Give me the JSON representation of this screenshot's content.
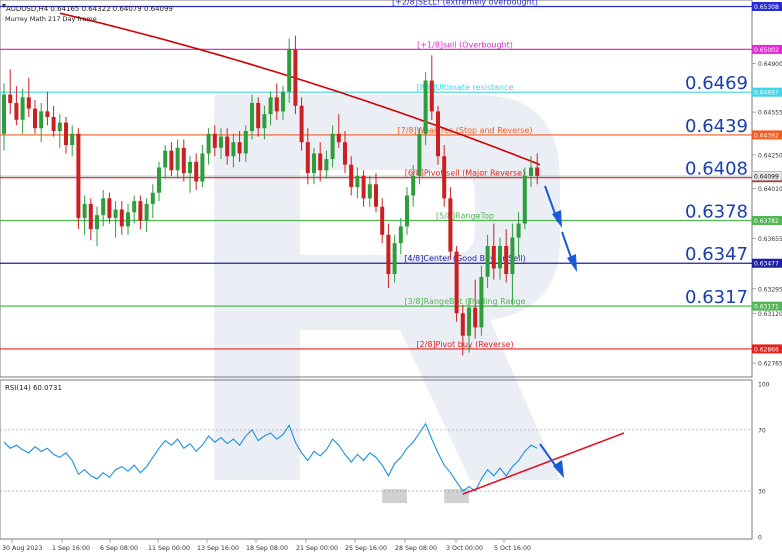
{
  "header": {
    "symbol_line": "AUDUSD,H4  0.64165 0.64322 0.64079 0.64099",
    "indicator_name": "Murrey Math 217 Day frame"
  },
  "colors": {
    "bull_candle": "#2e9e3c",
    "bear_candle": "#cc1f1f",
    "ma_line": "#d40000",
    "rsi_line": "#1e8fe0",
    "rsi_trend_line": "#e0162b",
    "arrow": "#1a5ad6"
  },
  "chart_data": [
    {
      "type": "candlestick",
      "ylim": [
        0.6268,
        0.6534
      ],
      "price_axis_ticks": [
        "0.65308",
        "0.65002",
        "0.64900",
        "0.64697",
        "0.64555",
        "0.64392",
        "0.64250",
        "0.64087",
        "0.64010",
        "0.63782",
        "0.63655",
        "0.63477",
        "0.63295",
        "0.63171",
        "0.63120",
        "0.62866",
        "0.62765"
      ],
      "x_labels": [
        "30 Aug 2023",
        "1 Sep 16:00",
        "6 Sep 08:00",
        "11 Sep 00:00",
        "13 Sep 16:00",
        "18 Sep 08:00",
        "21 Sep 00:00",
        "25 Sep 16:00",
        "28 Sep 08:00",
        "3 Oct 00:00",
        "5 Oct 16:00"
      ],
      "murrey_levels": [
        {
          "label": "[+2/8]SELL! (extremely overbought)",
          "value": 0.65308,
          "color": "#2a2ad6",
          "tag": "0.65308",
          "big": ""
        },
        {
          "label": "[+1/8]sell (Overbought)",
          "value": 0.65002,
          "color": "#e62ad6",
          "tag": "0.65002",
          "big": ""
        },
        {
          "label": "[8/8]Ultimate resistance",
          "value": 0.64697,
          "color": "#3fd6e6",
          "tag": "0.64697",
          "big": "0.6469"
        },
        {
          "label": "[7/8]Weak res (Stop and Reverse)",
          "value": 0.64392,
          "color": "#f25c1f",
          "tag": "0.64392",
          "big": "0.6439"
        },
        {
          "label": "[6/8]Pivot sell (Major Reverse)",
          "value": 0.64087,
          "color": "#e62020",
          "tag": "0.64087",
          "big": "0.6408"
        },
        {
          "label": "[5/8]RangeTop",
          "value": 0.63782,
          "color": "#52b652",
          "tag": "0.63782",
          "big": "0.6378"
        },
        {
          "label": "[4/8]Center (Good Buy or Sell)",
          "value": 0.63477,
          "color": "#1f1fa8",
          "tag": "0.63477",
          "big": "0.6347"
        },
        {
          "label": "[3/8]RangeBot (Trading Range",
          "value": 0.63171,
          "color": "#52b652",
          "tag": "0.63171",
          "big": "0.6317"
        },
        {
          "label": "[2/8]Pivot buy (Reverse)",
          "value": 0.62866,
          "color": "#e62020",
          "tag": "0.62866",
          "big": ""
        }
      ],
      "current_price": {
        "value": 0.64099,
        "tag": "0.64099"
      },
      "candles": [
        [
          0.644,
          0.6476,
          0.6428,
          0.6468
        ],
        [
          0.6468,
          0.6486,
          0.6454,
          0.6462
        ],
        [
          0.6462,
          0.6474,
          0.6446,
          0.645
        ],
        [
          0.645,
          0.6472,
          0.644,
          0.6466
        ],
        [
          0.6466,
          0.648,
          0.6452,
          0.6458
        ],
        [
          0.6458,
          0.6464,
          0.644,
          0.6444
        ],
        [
          0.6444,
          0.6462,
          0.6434,
          0.6456
        ],
        [
          0.6456,
          0.647,
          0.6446,
          0.6452
        ],
        [
          0.6452,
          0.646,
          0.6438,
          0.6442
        ],
        [
          0.6442,
          0.6454,
          0.643,
          0.6448
        ],
        [
          0.6448,
          0.6452,
          0.6426,
          0.6432
        ],
        [
          0.6432,
          0.6446,
          0.6424,
          0.644
        ],
        [
          0.644,
          0.6444,
          0.6372,
          0.638
        ],
        [
          0.638,
          0.6396,
          0.6368,
          0.639
        ],
        [
          0.639,
          0.6394,
          0.6364,
          0.6372
        ],
        [
          0.6372,
          0.6388,
          0.636,
          0.6382
        ],
        [
          0.6382,
          0.64,
          0.6374,
          0.6394
        ],
        [
          0.6394,
          0.6398,
          0.6376,
          0.638
        ],
        [
          0.638,
          0.6392,
          0.6366,
          0.6386
        ],
        [
          0.6386,
          0.6392,
          0.6368,
          0.6374
        ],
        [
          0.6374,
          0.639,
          0.6368,
          0.6384
        ],
        [
          0.6384,
          0.6396,
          0.6376,
          0.6392
        ],
        [
          0.6392,
          0.6396,
          0.6372,
          0.6378
        ],
        [
          0.6378,
          0.6394,
          0.637,
          0.639
        ],
        [
          0.639,
          0.6404,
          0.638,
          0.6398
        ],
        [
          0.6398,
          0.642,
          0.6392,
          0.6416
        ],
        [
          0.6416,
          0.6432,
          0.6408,
          0.6428
        ],
        [
          0.6428,
          0.6434,
          0.641,
          0.6414
        ],
        [
          0.6414,
          0.6436,
          0.6408,
          0.643
        ],
        [
          0.643,
          0.6436,
          0.6406,
          0.6412
        ],
        [
          0.6412,
          0.6424,
          0.6398,
          0.642
        ],
        [
          0.642,
          0.6426,
          0.64,
          0.6406
        ],
        [
          0.6406,
          0.6432,
          0.6402,
          0.6426
        ],
        [
          0.6426,
          0.6444,
          0.6418,
          0.644
        ],
        [
          0.644,
          0.6446,
          0.6424,
          0.643
        ],
        [
          0.643,
          0.6444,
          0.6422,
          0.6438
        ],
        [
          0.6438,
          0.6444,
          0.6418,
          0.6424
        ],
        [
          0.6424,
          0.644,
          0.6416,
          0.6434
        ],
        [
          0.6434,
          0.6442,
          0.642,
          0.6426
        ],
        [
          0.6426,
          0.6446,
          0.642,
          0.6442
        ],
        [
          0.6442,
          0.6468,
          0.6436,
          0.6462
        ],
        [
          0.6462,
          0.6466,
          0.6438,
          0.6444
        ],
        [
          0.6444,
          0.646,
          0.6436,
          0.6454
        ],
        [
          0.6454,
          0.647,
          0.6446,
          0.6466
        ],
        [
          0.6466,
          0.6476,
          0.645,
          0.6456
        ],
        [
          0.6456,
          0.6474,
          0.645,
          0.647
        ],
        [
          0.647,
          0.6508,
          0.6462,
          0.65
        ],
        [
          0.65,
          0.651,
          0.6454,
          0.646
        ],
        [
          0.646,
          0.6466,
          0.6428,
          0.6434
        ],
        [
          0.6434,
          0.6444,
          0.6404,
          0.6412
        ],
        [
          0.6412,
          0.643,
          0.6404,
          0.6426
        ],
        [
          0.6426,
          0.6434,
          0.6406,
          0.6414
        ],
        [
          0.6414,
          0.6428,
          0.6408,
          0.6422
        ],
        [
          0.6422,
          0.6446,
          0.6416,
          0.644
        ],
        [
          0.644,
          0.6454,
          0.643,
          0.6434
        ],
        [
          0.6434,
          0.6442,
          0.6412,
          0.6418
        ],
        [
          0.6418,
          0.6424,
          0.6396,
          0.6402
        ],
        [
          0.6402,
          0.6416,
          0.6394,
          0.641
        ],
        [
          0.641,
          0.6414,
          0.6388,
          0.6394
        ],
        [
          0.6394,
          0.641,
          0.6388,
          0.6404
        ],
        [
          0.6404,
          0.6412,
          0.6384,
          0.6388
        ],
        [
          0.6388,
          0.6394,
          0.6362,
          0.6368
        ],
        [
          0.6368,
          0.6376,
          0.633,
          0.634
        ],
        [
          0.634,
          0.6368,
          0.6334,
          0.6362
        ],
        [
          0.6362,
          0.638,
          0.6354,
          0.6374
        ],
        [
          0.6374,
          0.6402,
          0.6368,
          0.6396
        ],
        [
          0.6396,
          0.6418,
          0.6388,
          0.641
        ],
        [
          0.641,
          0.6444,
          0.6404,
          0.644
        ],
        [
          0.644,
          0.6484,
          0.6432,
          0.6478
        ],
        [
          0.6478,
          0.6496,
          0.645,
          0.6456
        ],
        [
          0.6456,
          0.646,
          0.6418,
          0.6424
        ],
        [
          0.6424,
          0.6432,
          0.6388,
          0.6394
        ],
        [
          0.6394,
          0.6402,
          0.635,
          0.6356
        ],
        [
          0.6356,
          0.636,
          0.6306,
          0.6312
        ],
        [
          0.6312,
          0.6318,
          0.6282,
          0.6296
        ],
        [
          0.6296,
          0.6322,
          0.6284,
          0.6316
        ],
        [
          0.6316,
          0.6336,
          0.6294,
          0.6302
        ],
        [
          0.6302,
          0.6346,
          0.6296,
          0.6338
        ],
        [
          0.6338,
          0.6368,
          0.633,
          0.636
        ],
        [
          0.636,
          0.6376,
          0.6336,
          0.6344
        ],
        [
          0.6344,
          0.6366,
          0.6336,
          0.636
        ],
        [
          0.636,
          0.6372,
          0.6334,
          0.634
        ],
        [
          0.634,
          0.6376,
          0.6318,
          0.6366
        ],
        [
          0.6366,
          0.6384,
          0.6352,
          0.6376
        ],
        [
          0.6376,
          0.6416,
          0.6372,
          0.641
        ],
        [
          0.641,
          0.6424,
          0.6402,
          0.6416
        ],
        [
          0.6416,
          0.6426,
          0.6404,
          0.641
        ]
      ],
      "moving_average": {
        "period": 217,
        "start": 0.6526,
        "end": 0.6418
      }
    },
    {
      "type": "line",
      "title": "RSI(14) 60.0731",
      "ylim": [
        0,
        100
      ],
      "levels": [
        70,
        30
      ],
      "y_ticks": [
        "100",
        "70",
        "30",
        "0"
      ],
      "values": [
        62,
        58,
        60,
        57,
        55,
        59,
        56,
        58,
        54,
        52,
        55,
        50,
        41,
        44,
        40,
        38,
        42,
        39,
        44,
        46,
        43,
        47,
        42,
        46,
        52,
        58,
        63,
        60,
        64,
        58,
        61,
        56,
        60,
        66,
        62,
        65,
        61,
        64,
        60,
        66,
        70,
        63,
        66,
        68,
        64,
        67,
        73,
        62,
        55,
        50,
        56,
        53,
        57,
        64,
        60,
        54,
        49,
        54,
        50,
        55,
        52,
        47,
        40,
        48,
        52,
        58,
        62,
        68,
        74,
        64,
        55,
        47,
        42,
        36,
        30,
        33,
        30,
        38,
        44,
        40,
        45,
        40,
        46,
        50,
        56,
        60,
        58
      ],
      "trend_line": {
        "from_index": 74,
        "from_value": 28,
        "to_index": 100,
        "to_value": 68
      },
      "highlight_boxes": [
        {
          "index_from": 61,
          "index_to": 65,
          "value": 30
        },
        {
          "index_from": 71,
          "index_to": 75,
          "value": 30
        }
      ]
    }
  ]
}
